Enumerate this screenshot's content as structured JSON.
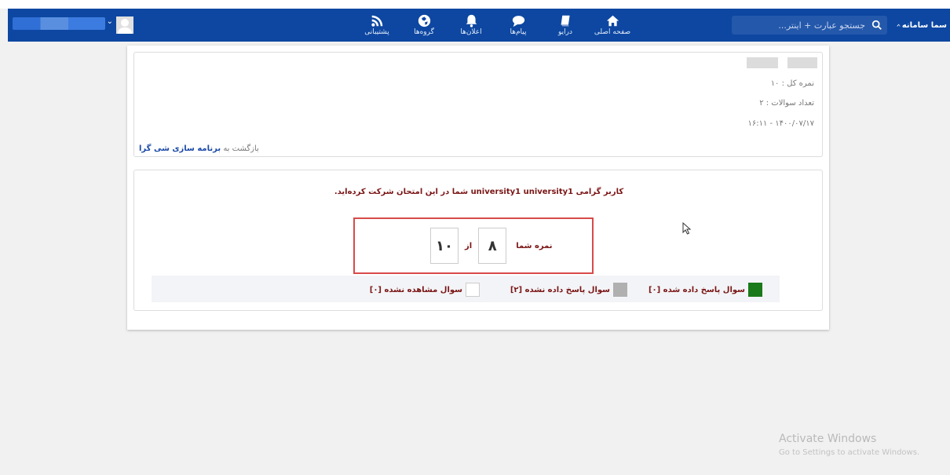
{
  "navbar": {
    "logo_text": "سما سامانه",
    "search_placeholder": "جستجو عبارت + اینتر...",
    "items": [
      {
        "label": "صفحه اصلی",
        "icon": "home-icon"
      },
      {
        "label": "درایو",
        "icon": "drive-icon"
      },
      {
        "label": "پیام‌ها",
        "icon": "chat-icon"
      },
      {
        "label": "اعلان‌ها",
        "icon": "bell-icon"
      },
      {
        "label": "گروه‌ها",
        "icon": "globe-icon"
      },
      {
        "label": "پشتیبانی",
        "icon": "rss-icon"
      }
    ],
    "user_caret": "⌄"
  },
  "info": {
    "total_score": "نمره کل : ۱۰",
    "question_count": "تعداد سوالات : ۲",
    "datetime": "۱۴۰۰/۰۷/۱۷ - ۱۶:۱۱",
    "back_prefix": "بازگشت به",
    "back_link": "برنامه سازی شی گرا"
  },
  "result": {
    "message": "کاربر گرامی university1 university1 شما در این امتحان شرکت کرده‌اید.",
    "score_label": "نمره شما",
    "score_value": "۸",
    "score_sep": "از",
    "score_total": "۱۰"
  },
  "legend": [
    {
      "label": "سوال پاسخ داده شده [۰]",
      "color": "#1a7a1a"
    },
    {
      "label": "سوال پاسخ داده نشده [۲]",
      "color": "#b0b0b0"
    },
    {
      "label": "سوال مشاهده نشده [۰]",
      "color": "#ffffff"
    }
  ],
  "watermark": {
    "title": "Activate Windows",
    "subtitle": "Go to Settings to activate Windows."
  }
}
